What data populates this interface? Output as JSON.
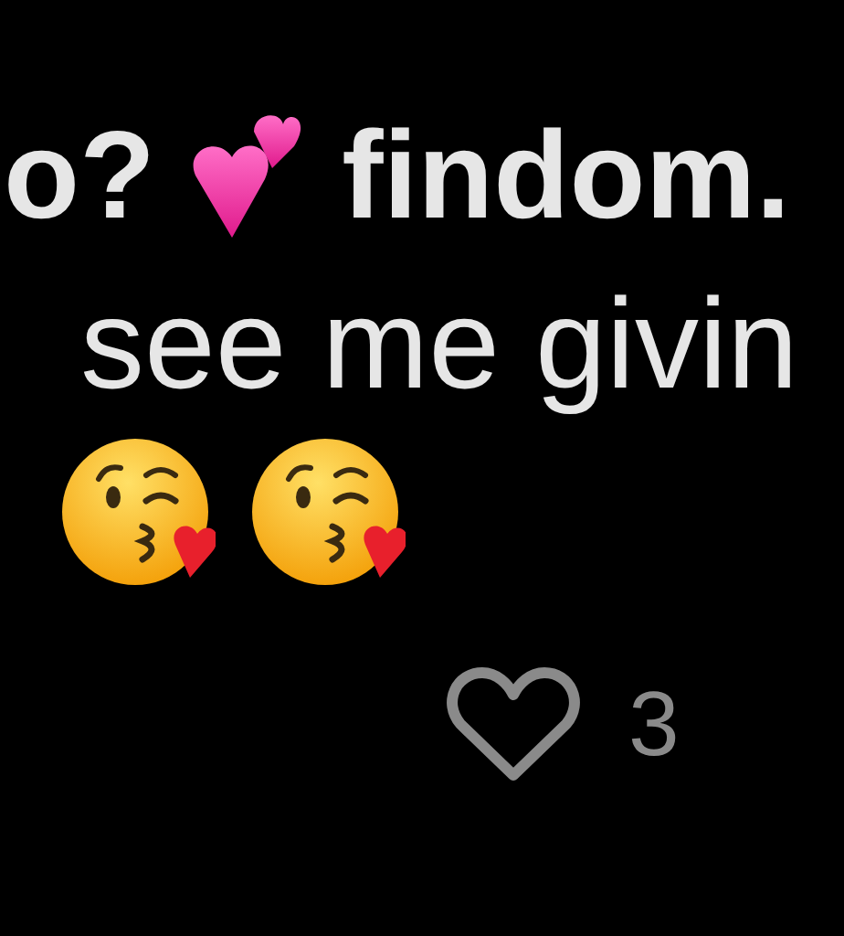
{
  "lines": [
    {
      "parts": [
        {
          "kind": "text",
          "text": "o?",
          "bold": true
        },
        {
          "kind": "two-hearts"
        },
        {
          "kind": "text",
          "text": "findom.",
          "bold": true
        }
      ]
    },
    {
      "parts": [
        {
          "kind": "text",
          "text": "see me givin",
          "bold": false
        }
      ]
    },
    {
      "parts": [
        {
          "kind": "kiss"
        },
        {
          "kind": "kiss"
        }
      ]
    }
  ],
  "likes": {
    "count": "3",
    "liked": false
  }
}
